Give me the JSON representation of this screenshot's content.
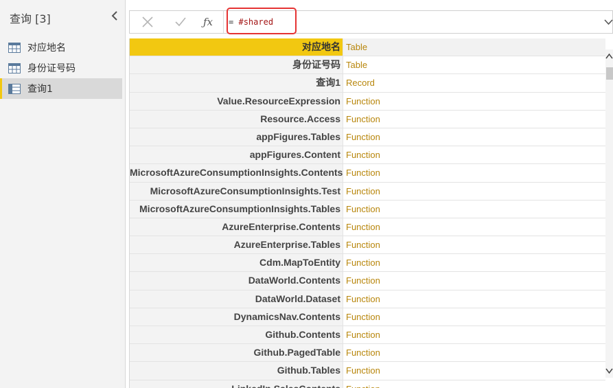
{
  "queries_pane": {
    "title": "查询 [3]",
    "items": [
      {
        "label": "对应地名",
        "icon": "table-icon",
        "selected": false
      },
      {
        "label": "身份证号码",
        "icon": "table-icon",
        "selected": false
      },
      {
        "label": "查询1",
        "icon": "record-icon",
        "selected": true
      }
    ]
  },
  "formula_bar": {
    "equals": "=",
    "expression": "#shared"
  },
  "grid": {
    "rows": [
      {
        "name": "对应地名",
        "value": "Table"
      },
      {
        "name": "身份证号码",
        "value": "Table"
      },
      {
        "name": "查询1",
        "value": "Record"
      },
      {
        "name": "Value.ResourceExpression",
        "value": "Function"
      },
      {
        "name": "Resource.Access",
        "value": "Function"
      },
      {
        "name": "appFigures.Tables",
        "value": "Function"
      },
      {
        "name": "appFigures.Content",
        "value": "Function"
      },
      {
        "name": "MicrosoftAzureConsumptionInsights.Contents",
        "value": "Function"
      },
      {
        "name": "MicrosoftAzureConsumptionInsights.Test",
        "value": "Function"
      },
      {
        "name": "MicrosoftAzureConsumptionInsights.Tables",
        "value": "Function"
      },
      {
        "name": "AzureEnterprise.Contents",
        "value": "Function"
      },
      {
        "name": "AzureEnterprise.Tables",
        "value": "Function"
      },
      {
        "name": "Cdm.MapToEntity",
        "value": "Function"
      },
      {
        "name": "DataWorld.Contents",
        "value": "Function"
      },
      {
        "name": "DataWorld.Dataset",
        "value": "Function"
      },
      {
        "name": "DynamicsNav.Contents",
        "value": "Function"
      },
      {
        "name": "Github.Contents",
        "value": "Function"
      },
      {
        "name": "Github.PagedTable",
        "value": "Function"
      },
      {
        "name": "Github.Tables",
        "value": "Function"
      },
      {
        "name": "LinkedIn.SalesContents",
        "value": "Function"
      }
    ]
  },
  "colors": {
    "accent": "#f2c811",
    "highlight_box": "#e53333",
    "value_text": "#b8860b",
    "expression_text": "#a31515"
  }
}
